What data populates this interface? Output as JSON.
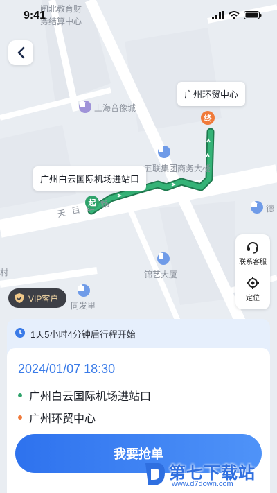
{
  "status_bar": {
    "time": "9:41"
  },
  "map": {
    "labels": {
      "top_left_1": "闸北教育财",
      "top_left_2": "务结算中心",
      "shanghai_audio": "上海音像城",
      "business_tower": "五联集团商务大楼",
      "road": "天 目 西 路",
      "de": "德",
      "cun": "村",
      "jinyi": "锦艺大厦",
      "tongfa": "同发里"
    },
    "start_callout": "广州白云国际机场进站口",
    "end_callout": "广州环贸中心",
    "start_pin": "起",
    "end_pin": "终"
  },
  "tools": {
    "service_label": "联系客服",
    "locate_label": "定位"
  },
  "vip": {
    "label": "VIP客户"
  },
  "order": {
    "countdown": "1天5小时4分钟后行程开始",
    "datetime": "2024/01/07 18:30",
    "from": "广州白云国际机场进站口",
    "to": "广州环贸中心",
    "action_label": "我要抢单"
  },
  "watermark": {
    "main": "第七下载站",
    "sub": "www.d7down.com"
  },
  "colors": {
    "accent": "#3a7be8",
    "route": "#2fa36b",
    "start_dot": "#2fa36b",
    "end_dot": "#f07a3a"
  }
}
